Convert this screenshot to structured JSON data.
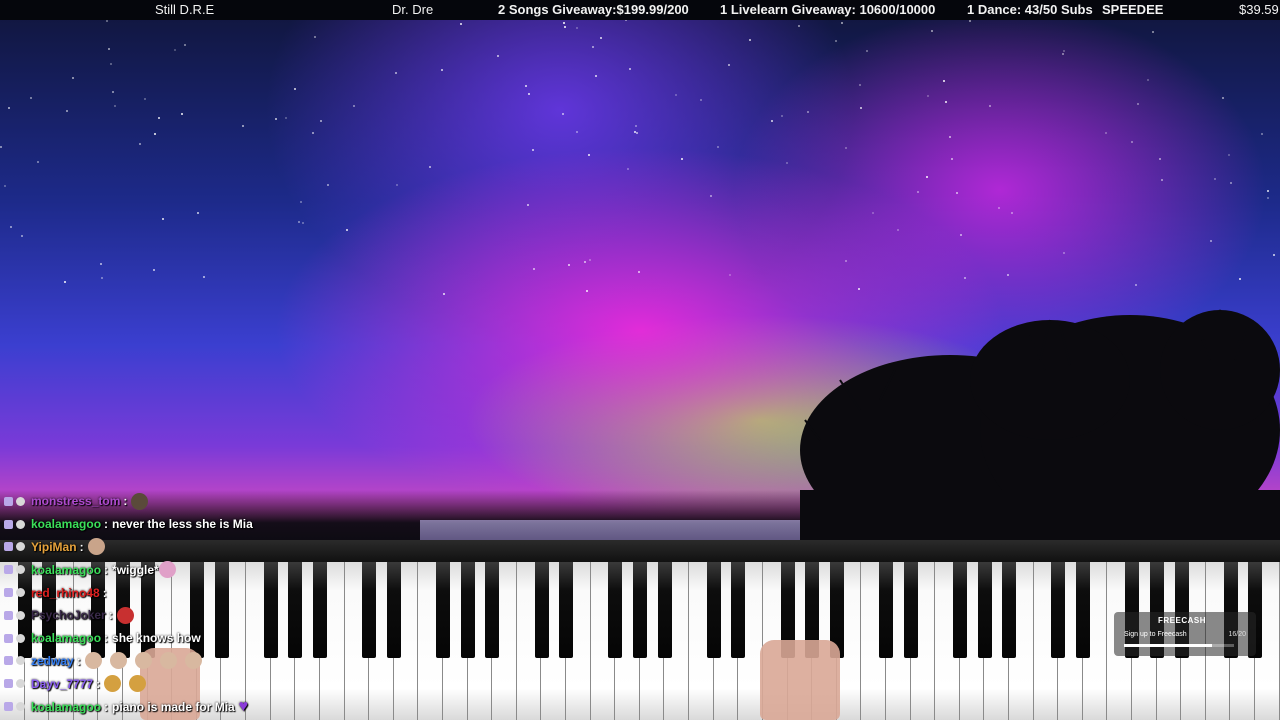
{
  "topbar": {
    "song_title": "Still D.R.E",
    "artist": "Dr. Dre",
    "goal_songs": "2 Songs Giveaway:$199.99/200",
    "goal_livelearn": "1 Livelearn Giveaway: 10600/10000",
    "goal_dance": "1 Dance: 43/50 Subs",
    "latest": "SPEEDEE",
    "amount": "$39.59"
  },
  "chat": [
    {
      "user": "monstress_tom",
      "color": "#b04bd0",
      "text": "",
      "emotes": [
        "dark-face"
      ]
    },
    {
      "user": "koalamagoo",
      "color": "#3be05a",
      "text": "never the less she is Mia",
      "emotes": []
    },
    {
      "user": "YipiMan",
      "color": "#e5a23b",
      "text": "",
      "emotes": [
        "hand"
      ]
    },
    {
      "user": "koalamagoo",
      "color": "#3be05a",
      "text": "*wiggle*",
      "emotes": [
        "pink-face"
      ]
    },
    {
      "user": "red_rhino48",
      "color": "#e02020",
      "text": "",
      "emotes": []
    },
    {
      "user": "PsychoJoker",
      "color": "#3a2a4a",
      "text": "",
      "emotes": [
        "red-face"
      ]
    },
    {
      "user": "koalamagoo",
      "color": "#3be05a",
      "text": "she knows how",
      "emotes": []
    },
    {
      "user": "zedway",
      "color": "#2f7af0",
      "text": "",
      "emotes": [
        "face",
        "face",
        "face",
        "face",
        "face"
      ]
    },
    {
      "user": "Dayv_7777",
      "color": "#8a5cf0",
      "text": "",
      "emotes": [
        "lion",
        "lion"
      ]
    },
    {
      "user": "koalamagoo",
      "color": "#3be05a",
      "text": "piano is made for Mia",
      "emotes": [
        "purple-heart"
      ]
    }
  ],
  "freecash": {
    "logo": "FREECASH",
    "cta": "Sign up to Freecash",
    "count": "16/20",
    "progress": 0.8
  },
  "colors": {
    "topbar_bg": "#05060c",
    "aurora_pink": "#ff28dc",
    "aurora_green": "#96ff3c",
    "sky_blue": "#1d2a8a"
  }
}
